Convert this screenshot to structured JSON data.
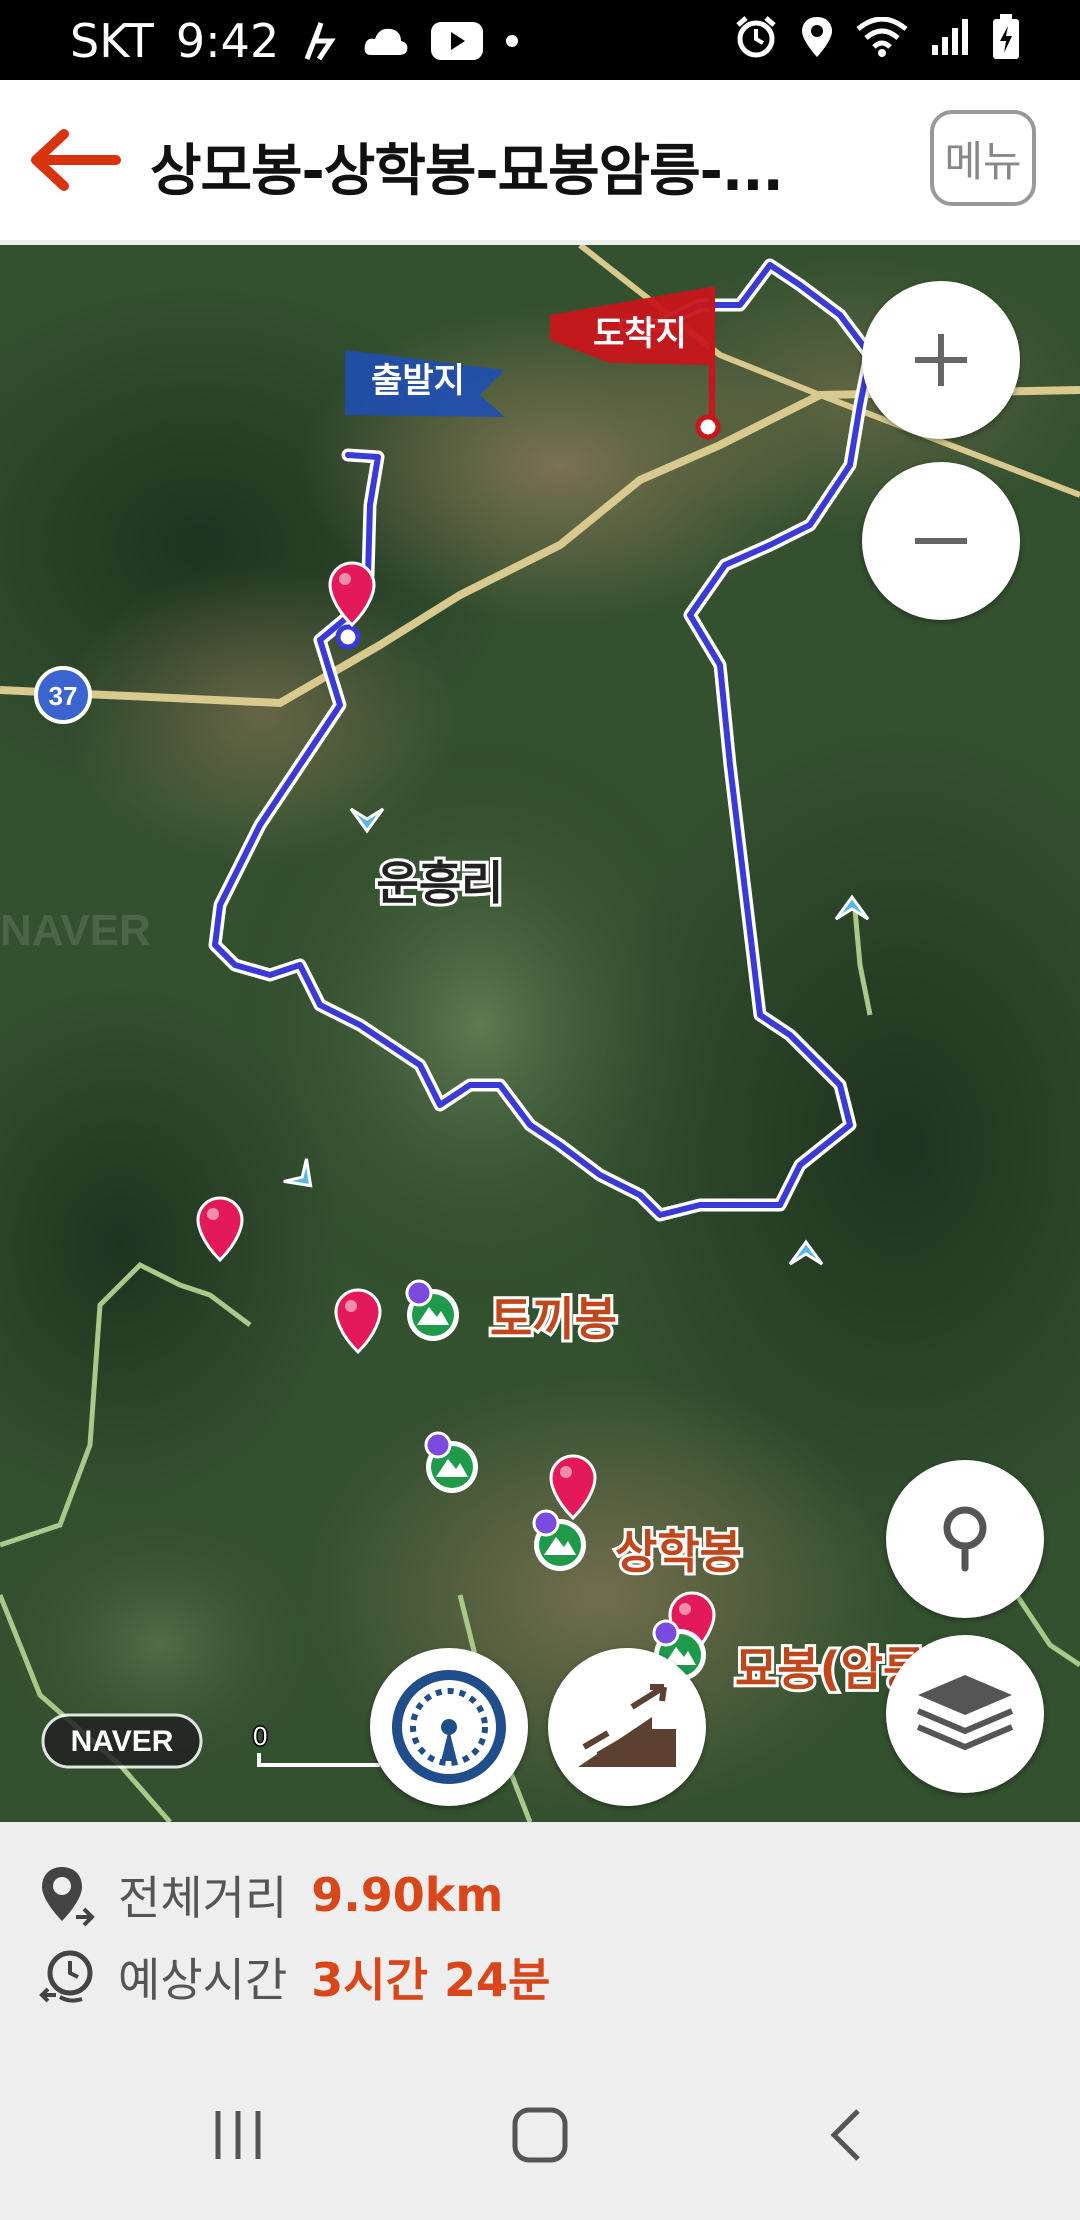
{
  "status": {
    "carrier": "SKT",
    "time": "9:42"
  },
  "header": {
    "title": "상모봉-상학봉-묘봉암릉-...",
    "menu_label": "메뉴"
  },
  "map": {
    "start_flag": "출발지",
    "end_flag": "도착지",
    "village": "운흥리",
    "route_badge": "37",
    "peaks": [
      "토끼봉",
      "상학봉",
      "묘봉(암릉"
    ],
    "scale_label": "0",
    "watermark": "NAVER",
    "provider_logo": "NAVER",
    "route_color": "#3a3ad6",
    "flag_start_color": "#1f4fb0",
    "flag_end_color": "#c8161b",
    "pin_color": "#e3195a"
  },
  "info": {
    "distance_label": "전체거리",
    "distance_value": "9.90km",
    "time_label": "예상시간",
    "time_value": "3시간 24분"
  }
}
